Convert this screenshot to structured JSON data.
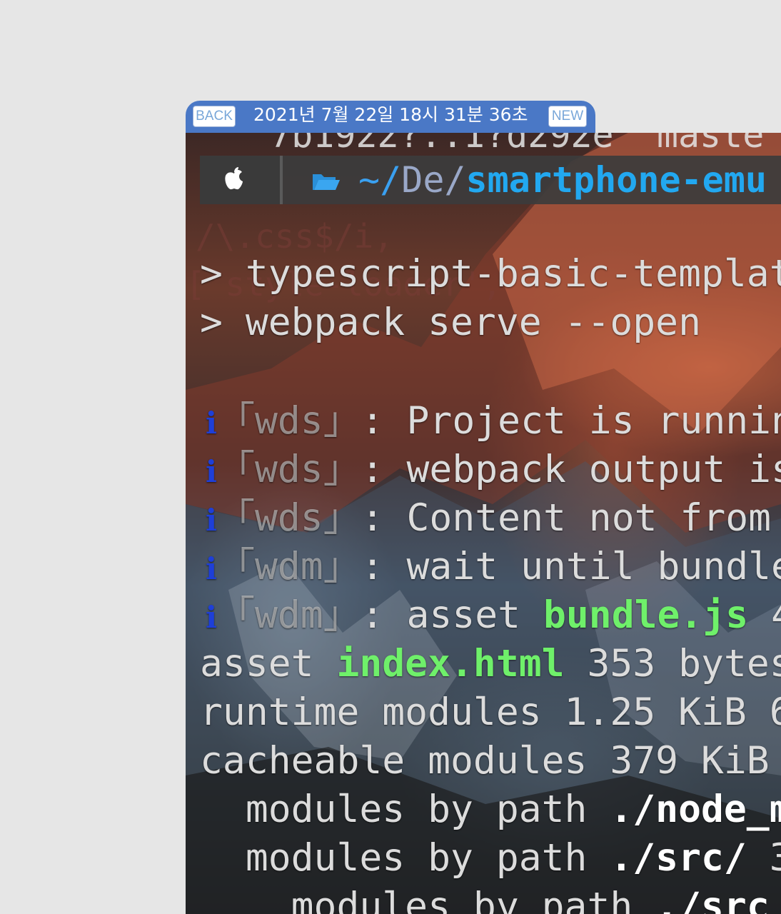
{
  "window": {
    "back_label": "BACK",
    "new_label": "NEW",
    "timestamp": "2021년 7월 22일 18시 31분 36초"
  },
  "terminal": {
    "top_partial": "7b1922?..1?d292e  maste",
    "prompt": {
      "apple_icon": "apple-logo-icon",
      "folder_icon": "folder-open-icon",
      "path_tilde": "~/",
      "path_dim": "De/",
      "path_bold": "smartphone-emu"
    },
    "ghost_lines": [
      "/\\.css$/i,",
      "['style-loader',"
    ],
    "lines": {
      "cmd1": "> typescript-basic-templat",
      "cmd2": "> webpack serve --open",
      "wds1_tag": "「wds」",
      "wds1_text": ": Project is runnin",
      "wds2_tag": "「wds」",
      "wds2_text": ": webpack output is",
      "wds3_tag": "「wds」",
      "wds3_text": ": Content not from",
      "wdm1_tag": "「wdm」",
      "wdm1_text": ": wait until bundle",
      "wdm2_tag": "「wdm」",
      "wdm2_text": ": asset ",
      "wdm2_file": "bundle.js",
      "wdm2_rest": " 4",
      "asset_prefix": "asset ",
      "asset_file": "index.html",
      "asset_rest": " 353 bytes",
      "runtime": "runtime modules 1.25 KiB 6",
      "cacheable": "cacheable modules 379 KiB",
      "mod1_prefix": "  modules by path ",
      "mod1_path": "./node_m",
      "mod2_prefix": "  modules by path ",
      "mod2_path": "./src/",
      "mod2_rest": " 3",
      "mod3_prefix": "    modules by path ",
      "mod3_path": "./src"
    },
    "info_glyph": "i"
  }
}
